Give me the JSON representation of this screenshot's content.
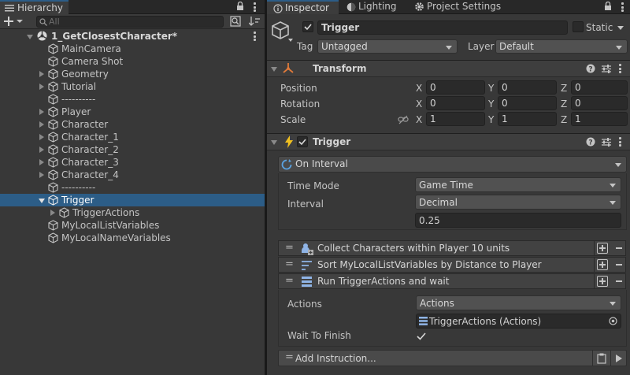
{
  "hierarchy": {
    "tab_label": "Hierarchy",
    "search_placeholder": "All",
    "scene": "1_GetClosestCharacter*",
    "items": [
      {
        "label": "MainCamera"
      },
      {
        "label": "Camera Shot"
      },
      {
        "label": "Geometry"
      },
      {
        "label": "Tutorial"
      },
      {
        "label": "----------"
      },
      {
        "label": "Player"
      },
      {
        "label": "Character"
      },
      {
        "label": "Character_1"
      },
      {
        "label": "Character_2"
      },
      {
        "label": "Character_3"
      },
      {
        "label": "Character_4"
      },
      {
        "label": "----------"
      },
      {
        "label": "Trigger"
      },
      {
        "label": "TriggerActions"
      },
      {
        "label": "MyLocalListVariables"
      },
      {
        "label": "MyLocalNameVariables"
      }
    ]
  },
  "inspector": {
    "tabs": [
      "Inspector",
      "Lighting",
      "Project Settings"
    ],
    "object_name": "Trigger",
    "static_label": "Static",
    "tag_label": "Tag",
    "tag_value": "Untagged",
    "layer_label": "Layer",
    "layer_value": "Default",
    "transform": {
      "title": "Transform",
      "position_label": "Position",
      "rotation_label": "Rotation",
      "scale_label": "Scale",
      "axis": [
        "X",
        "Y",
        "Z"
      ],
      "position": [
        "0",
        "0",
        "0"
      ],
      "rotation": [
        "0",
        "0",
        "0"
      ],
      "scale": [
        "1",
        "1",
        "1"
      ]
    },
    "trigger": {
      "title": "Trigger",
      "event": "On Interval",
      "time_mode_label": "Time Mode",
      "time_mode_value": "Game Time",
      "interval_label": "Interval",
      "interval_type": "Decimal",
      "interval_value": "0.25",
      "instructions": [
        "Collect Characters within Player 10 units",
        "Sort MyLocalListVariables by Distance to Player",
        "Run TriggerActions and wait"
      ],
      "actions_label": "Actions",
      "actions_type": "Actions",
      "actions_ref": "TriggerActions (Actions)",
      "wait_label": "Wait To Finish",
      "add_instruction": "Add Instruction..."
    }
  },
  "colors": {
    "selection": "#2c5d87",
    "accent_transform": "#e07a3a",
    "accent_trigger": "#f0c020"
  }
}
